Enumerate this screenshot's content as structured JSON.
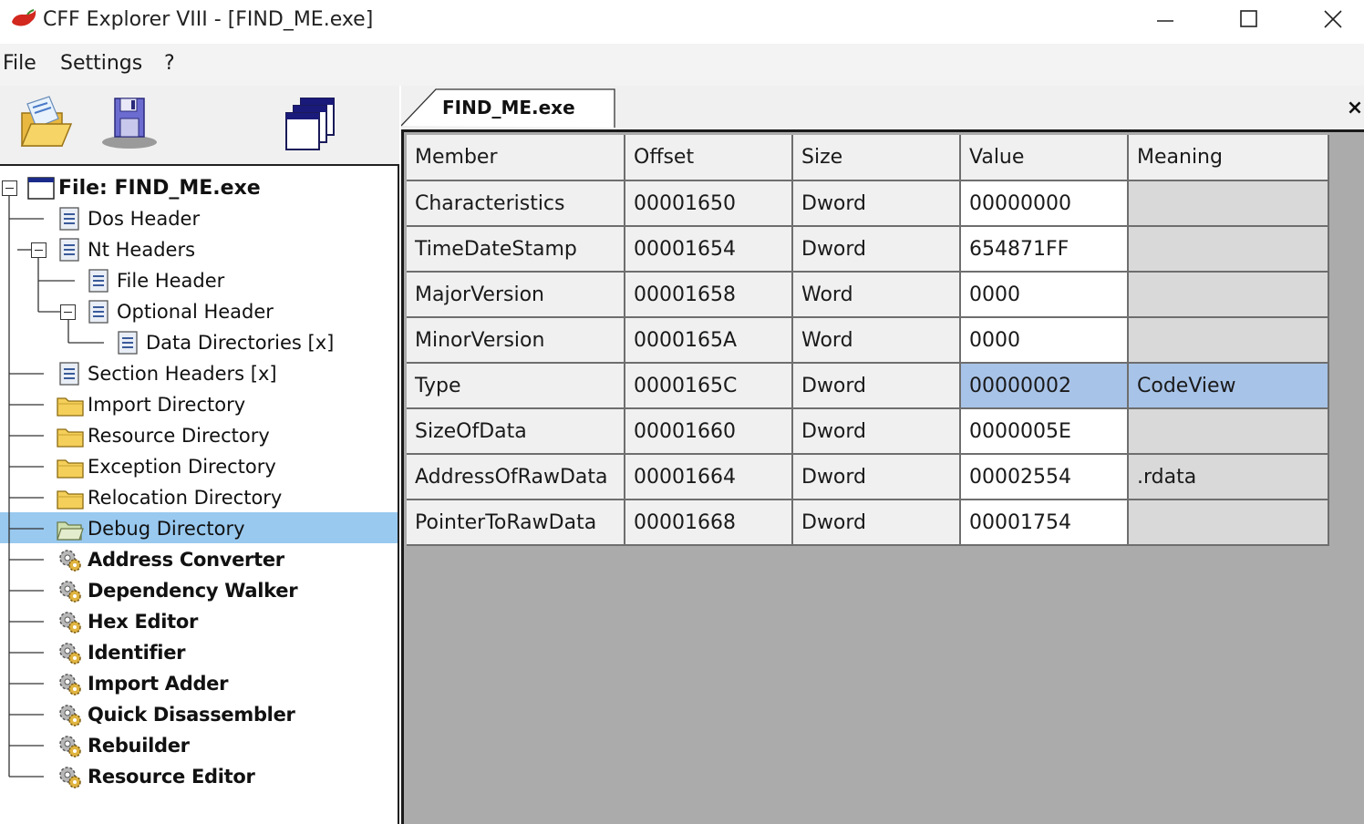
{
  "window": {
    "title": "CFF Explorer VIII - [FIND_ME.exe]"
  },
  "menu": {
    "file": "File",
    "settings": "Settings",
    "help": "?"
  },
  "toolbar": {
    "icons": [
      "open-folder-icon",
      "save-disk-icon",
      "windows-cascade-icon"
    ]
  },
  "tree": {
    "root": "File: FIND_ME.exe",
    "items": [
      {
        "label": "Dos Header",
        "icon": "document-icon"
      },
      {
        "label": "Nt Headers",
        "icon": "document-icon"
      },
      {
        "label": "File Header",
        "icon": "document-icon"
      },
      {
        "label": "Optional Header",
        "icon": "document-icon"
      },
      {
        "label": "Data Directories [x]",
        "icon": "document-icon"
      },
      {
        "label": "Section Headers [x]",
        "icon": "document-icon"
      },
      {
        "label": "Import Directory",
        "icon": "folder-icon"
      },
      {
        "label": "Resource Directory",
        "icon": "folder-icon"
      },
      {
        "label": "Exception Directory",
        "icon": "folder-icon"
      },
      {
        "label": "Relocation Directory",
        "icon": "folder-icon"
      },
      {
        "label": "Debug Directory",
        "icon": "folder-open-icon",
        "selected": true
      },
      {
        "label": "Address Converter",
        "icon": "tool-gear-icon"
      },
      {
        "label": "Dependency Walker",
        "icon": "tool-gear-icon"
      },
      {
        "label": "Hex Editor",
        "icon": "tool-gear-icon"
      },
      {
        "label": "Identifier",
        "icon": "tool-gear-icon"
      },
      {
        "label": "Import Adder",
        "icon": "tool-gear-icon"
      },
      {
        "label": "Quick Disassembler",
        "icon": "tool-gear-icon"
      },
      {
        "label": "Rebuilder",
        "icon": "tool-gear-icon"
      },
      {
        "label": "Resource Editor",
        "icon": "tool-gear-icon"
      }
    ]
  },
  "tab": {
    "label": "FIND_ME.exe",
    "close": "×"
  },
  "grid": {
    "columns": [
      "Member",
      "Offset",
      "Size",
      "Value",
      "Meaning"
    ],
    "rows": [
      [
        "Characteristics",
        "00001650",
        "Dword",
        "00000000",
        ""
      ],
      [
        "TimeDateStamp",
        "00001654",
        "Dword",
        "654871FF",
        ""
      ],
      [
        "MajorVersion",
        "00001658",
        "Word",
        "0000",
        ""
      ],
      [
        "MinorVersion",
        "0000165A",
        "Word",
        "0000",
        ""
      ],
      [
        "Type",
        "0000165C",
        "Dword",
        "00000002",
        "CodeView"
      ],
      [
        "SizeOfData",
        "00001660",
        "Dword",
        "0000005E",
        ""
      ],
      [
        "AddressOfRawData",
        "00001664",
        "Dword",
        "00002554",
        ".rdata"
      ],
      [
        "PointerToRawData",
        "00001668",
        "Dword",
        "00001754",
        ""
      ]
    ],
    "selected_row": 4
  },
  "colors": {
    "selection": "#99c9ef",
    "grid_selection": "#a8c3e8",
    "grid_background": "#ababab"
  }
}
